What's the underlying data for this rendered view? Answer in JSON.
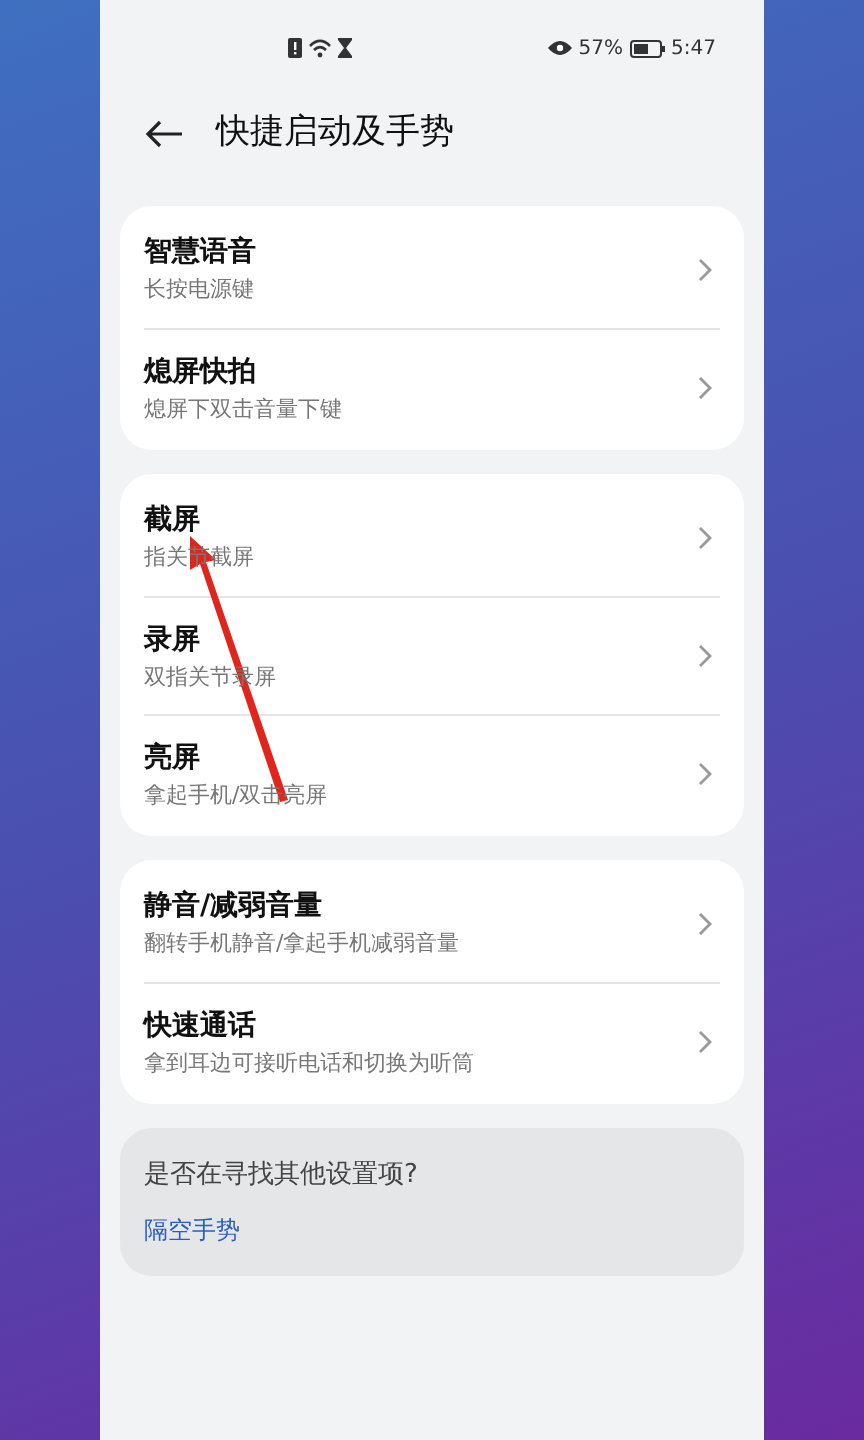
{
  "status_bar": {
    "battery_percent": "57%",
    "time": "5:47"
  },
  "header": {
    "title": "快捷启动及手势"
  },
  "groups": [
    {
      "items": [
        {
          "title": "智慧语音",
          "subtitle": "长按电源键"
        },
        {
          "title": "熄屏快拍",
          "subtitle": "熄屏下双击音量下键"
        }
      ]
    },
    {
      "items": [
        {
          "title": "截屏",
          "subtitle": "指关节截屏"
        },
        {
          "title": "录屏",
          "subtitle": "双指关节录屏"
        },
        {
          "title": "亮屏",
          "subtitle": "拿起手机/双击亮屏"
        }
      ]
    },
    {
      "items": [
        {
          "title": "静音/减弱音量",
          "subtitle": "翻转手机静音/拿起手机减弱音量"
        },
        {
          "title": "快速通话",
          "subtitle": "拿到耳边可接听电话和切换为听筒"
        }
      ]
    }
  ],
  "suggestion": {
    "question": "是否在寻找其他设置项?",
    "link": "隔空手势"
  }
}
